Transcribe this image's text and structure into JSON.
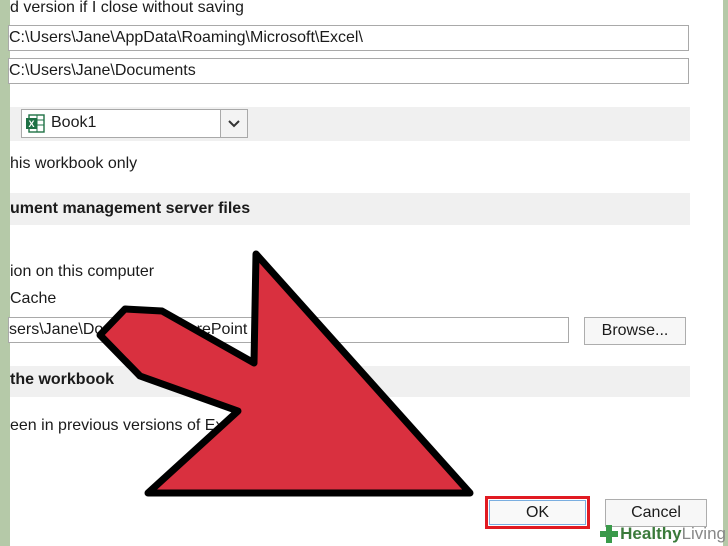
{
  "options": {
    "autorecover_keep_label": "d version if I close without saving",
    "autorecover_location": "C:\\Users\\Jane\\AppData\\Roaming\\Microsoft\\Excel\\",
    "default_local_location": "C:\\Users\\Jane\\Documents",
    "workbook_select_value": "Book1",
    "workbook_only_label": "his workbook only",
    "doc_mgmt_section": "ument management server files",
    "on_this_computer_label": "ion on this computer",
    "cache_label": "Cache",
    "server_drafts_location": "sers\\Jane\\Documents\\SharePoint Drafts",
    "browse_label": "Browse...",
    "preserve_section": "the workbook",
    "previous_versions_label": "een in previous versions of Excel"
  },
  "footer": {
    "ok_label": "OK",
    "cancel_label": "Cancel"
  },
  "watermark": {
    "healthy_label": "Healthy",
    "living_label": " Living"
  },
  "colors": {
    "arrow_fill": "#d9303f",
    "arrow_stroke": "#000000",
    "ok_highlight": "#e11a22",
    "excel_green": "#1e7145",
    "background": "#b5c9a8"
  },
  "icons": {
    "workbook_icon": "excel-icon",
    "dropdown_icon": "chevron-down-icon",
    "watermark_icon": "plus-icon"
  }
}
